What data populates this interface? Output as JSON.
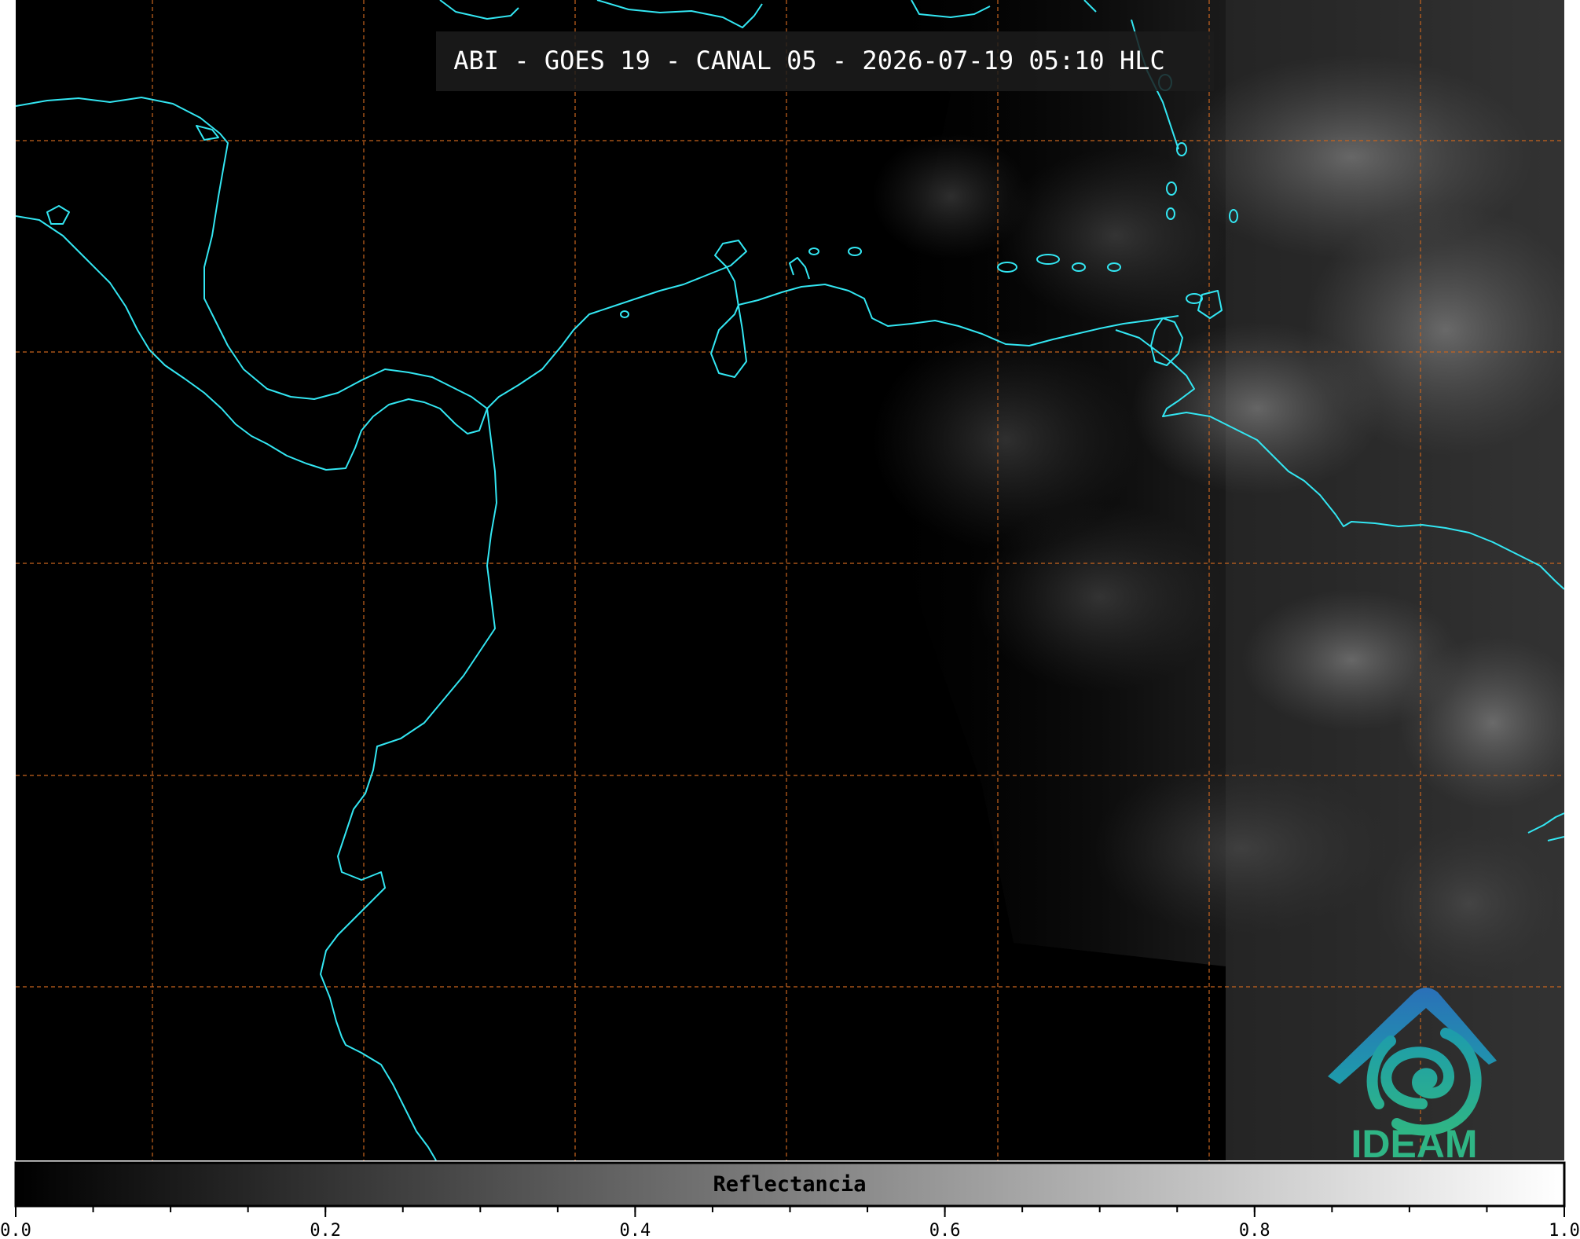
{
  "header": {
    "title": "ABI - GOES 19 - CANAL 05 - 2026-07-19 05:10 HLC"
  },
  "logo": {
    "text": "IDEAM",
    "colors": {
      "blue": "#2a70b8",
      "teal": "#1e9cab",
      "green": "#2fb585"
    }
  },
  "map": {
    "background_color": "#000000",
    "coastline_color": "#33e6f2",
    "grid_color": "#c8641e",
    "grid_style": "dashed",
    "cloud_region": "east"
  },
  "colorbar": {
    "label": "Reflectancia",
    "range": [
      0.0,
      1.0
    ],
    "ticks": [
      {
        "value": 0.0,
        "label": "0.0"
      },
      {
        "value": 0.2,
        "label": "0.2"
      },
      {
        "value": 0.4,
        "label": "0.4"
      },
      {
        "value": 0.6,
        "label": "0.6"
      },
      {
        "value": 0.8,
        "label": "0.8"
      },
      {
        "value": 1.0,
        "label": "1.0"
      }
    ],
    "minor_tick_step": 0.05,
    "gradient": {
      "start": "#000000",
      "end": "#ffffff"
    }
  }
}
